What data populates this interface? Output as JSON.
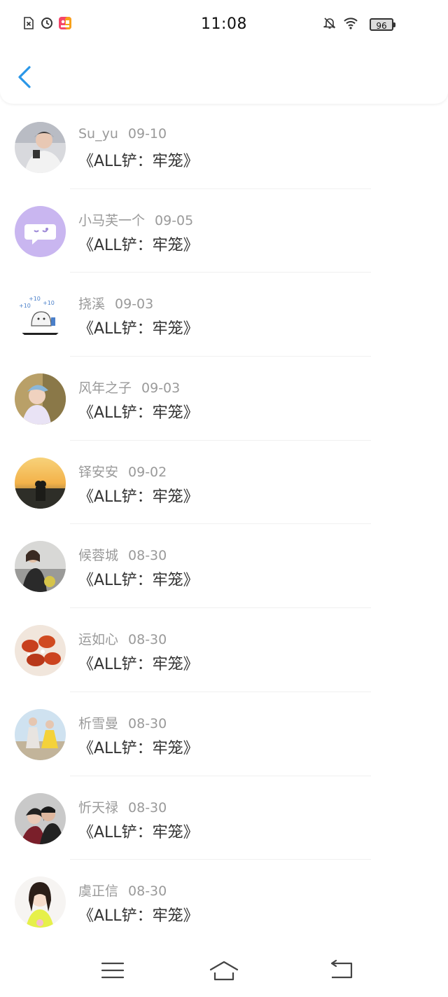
{
  "status_bar": {
    "time": "11:08",
    "battery": "96",
    "left_icons": [
      "sim-x-icon",
      "clock-circle-icon",
      "app-badge-icon"
    ],
    "right_icons": [
      "bell-off-icon",
      "wifi-icon",
      "battery-icon"
    ]
  },
  "header": {
    "back_icon": "chevron-left-icon",
    "accent_color": "#2a97e8"
  },
  "items": [
    {
      "name": "Su_yu",
      "date": "09-10",
      "title": "《ALL铲：牢笼》"
    },
    {
      "name": "小马芙一个",
      "date": "09-05",
      "title": "《ALL铲：牢笼》"
    },
    {
      "name": "挠溪",
      "date": "09-03",
      "title": "《ALL铲：牢笼》"
    },
    {
      "name": "风年之子",
      "date": "09-03",
      "title": "《ALL铲：牢笼》"
    },
    {
      "name": "铎安安",
      "date": "09-02",
      "title": "《ALL铲：牢笼》"
    },
    {
      "name": "候蓉城",
      "date": "08-30",
      "title": "《ALL铲：牢笼》"
    },
    {
      "name": "运如心",
      "date": "08-30",
      "title": "《ALL铲：牢笼》"
    },
    {
      "name": "析雪曼",
      "date": "08-30",
      "title": "《ALL铲：牢笼》"
    },
    {
      "name": "忻天禄",
      "date": "08-30",
      "title": "《ALL铲：牢笼》"
    },
    {
      "name": "虞正信",
      "date": "08-30",
      "title": "《ALL铲：牢笼》"
    }
  ],
  "nav_bar": {
    "icons": [
      "menu-icon",
      "home-icon",
      "back-nav-icon"
    ]
  }
}
